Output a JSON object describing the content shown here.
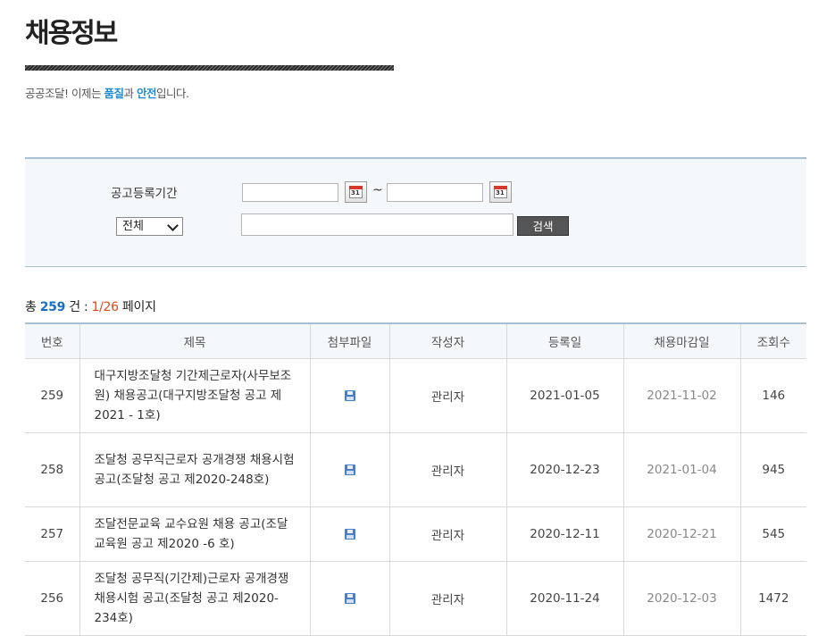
{
  "header": {
    "title": "채용정보",
    "slogan_prefix": "공공조달! 이제는 ",
    "slogan_hl1": "품질",
    "slogan_mid": "과 ",
    "slogan_hl2": "안전",
    "slogan_suffix": "입니다."
  },
  "search": {
    "period_label": "공고등록기간",
    "start_date": "",
    "end_date": "",
    "calendar_day": "31",
    "tilde": "~",
    "category_selected": "전체",
    "keyword": "",
    "search_button": "검색"
  },
  "summary": {
    "prefix": "총 ",
    "total": "259",
    "unit": " 건 : ",
    "page_info": "1/26",
    "suffix": " 페이지"
  },
  "table": {
    "headers": [
      "번호",
      "제목",
      "첨부파일",
      "작성자",
      "등록일",
      "채용마감일",
      "조회수"
    ],
    "rows": [
      {
        "no": "259",
        "title": "대구지방조달청 기간제근로자(사무보조원) 채용공고(대구지방조달청 공고 제2021 - 1호)",
        "author": "관리자",
        "registered": "2021-01-05",
        "deadline": "2021-11-02",
        "views": "146"
      },
      {
        "no": "258",
        "title": "조달청 공무직근로자 공개경쟁 채용시험 공고(조달청 공고 제2020-248호)",
        "author": "관리자",
        "registered": "2020-12-23",
        "deadline": "2021-01-04",
        "views": "945"
      },
      {
        "no": "257",
        "title": "조달전문교육 교수요원 채용 공고(조달교육원 공고 제2020 -6 호)",
        "author": "관리자",
        "registered": "2020-12-11",
        "deadline": "2020-12-21",
        "views": "545"
      },
      {
        "no": "256",
        "title": "조달청 공무직(기간제)근로자 공개경쟁 채용시험 공고(조달청 공고 제2020-234호)",
        "author": "관리자",
        "registered": "2020-11-24",
        "deadline": "2020-12-03",
        "views": "1472"
      }
    ]
  },
  "colors": {
    "accent_blue": "#1f8bd1",
    "page_orange": "#e0471b",
    "header_bg": "#f4f8fb"
  }
}
